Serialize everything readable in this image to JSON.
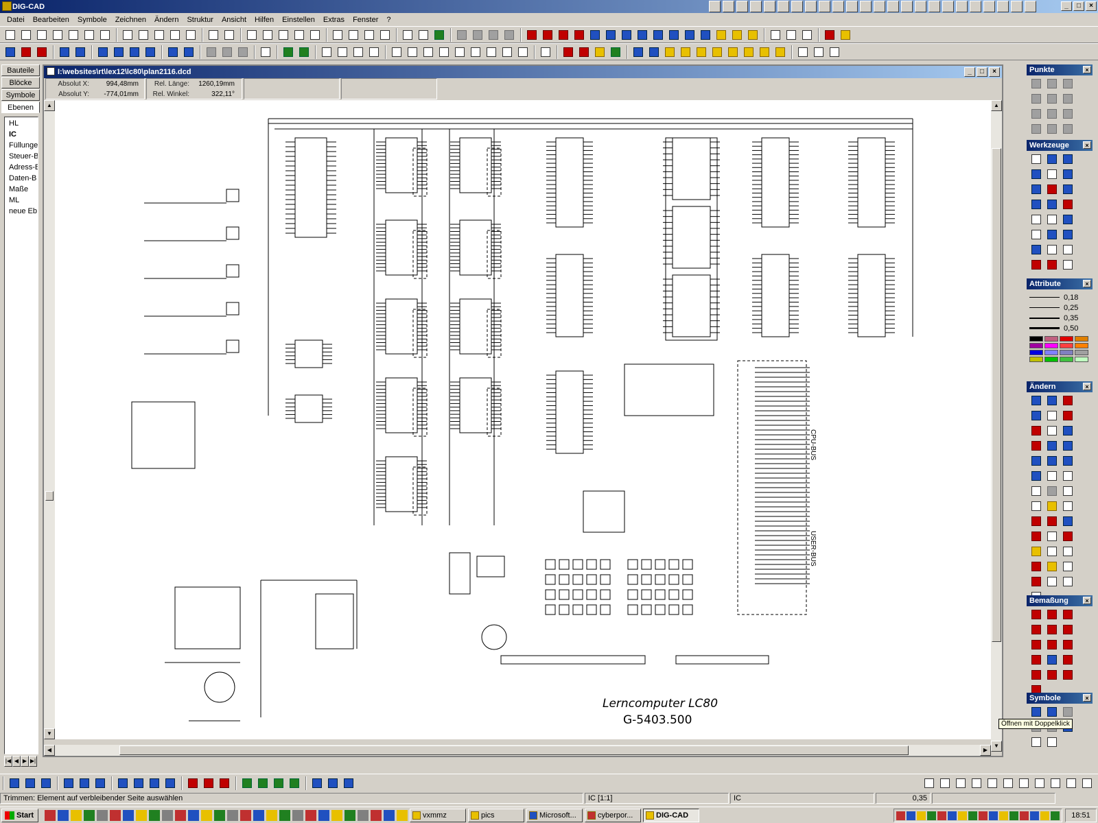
{
  "app": {
    "title": "DIG-CAD"
  },
  "menu": [
    "Datei",
    "Bearbeiten",
    "Symbole",
    "Zeichnen",
    "Ändern",
    "Struktur",
    "Ansicht",
    "Hilfen",
    "Einstellen",
    "Extras",
    "Fenster",
    "?"
  ],
  "left_tabs": [
    "Bauteile",
    "Blöcke",
    "Symbole",
    "Ebenen"
  ],
  "layers": [
    "HL",
    "IC",
    "Füllunge",
    "Steuer-B",
    "Adress-B",
    "Daten-B",
    "Maße",
    "ML",
    "neue Eb"
  ],
  "document": {
    "title": "I:\\websites\\rt\\lex12\\lc80\\plan2116.dcd",
    "coords": {
      "abs_x_label": "Absolut X:",
      "abs_x_value": "994,48mm",
      "abs_y_label": "Absolut Y:",
      "abs_y_value": "-774,01mm",
      "rel_len_label": "Rel. Länge:",
      "rel_len_value": "1260,19mm",
      "rel_ang_label": "Rel. Winkel:",
      "rel_ang_value": "322,11°"
    },
    "drawing": {
      "caption_line1": "Lerncomputer LC80",
      "caption_line2": "G-5403.500",
      "cpu_bus": "CPU-BUS",
      "user_bus": "USER-BUS"
    }
  },
  "right_panels": {
    "punkte": "Punkte",
    "werkzeuge": "Werkzeuge",
    "attribute": "Attribute",
    "line_widths": [
      "0,18",
      "0,25",
      "0,35",
      "0,50"
    ],
    "aendern": "Ändern",
    "bemassung": "Bemaßung",
    "symbole": "Symbole",
    "colors": [
      "#000000",
      "#c06080",
      "#e00000",
      "#e08000",
      "#a000a0",
      "#ff00ff",
      "#ff4040",
      "#ff8000",
      "#0000e0",
      "#8080ff",
      "#8080c0",
      "#a0a0a0",
      "#c0c000",
      "#00c000",
      "#40c040",
      "#c0ffc0"
    ]
  },
  "tooltip": "Öffnen mit Doppelklick",
  "status": {
    "message": "Trimmen: Element auf verbleibender Seite auswählen",
    "layer_ic": "IC [1:1]",
    "active": "IC",
    "line_width": "0,35"
  },
  "taskbar": {
    "start": "Start",
    "buttons": [
      "vxmmz",
      "pics",
      "Microsoft...",
      "cyberpor...",
      "DIG-CAD"
    ],
    "clock": "18:51"
  }
}
